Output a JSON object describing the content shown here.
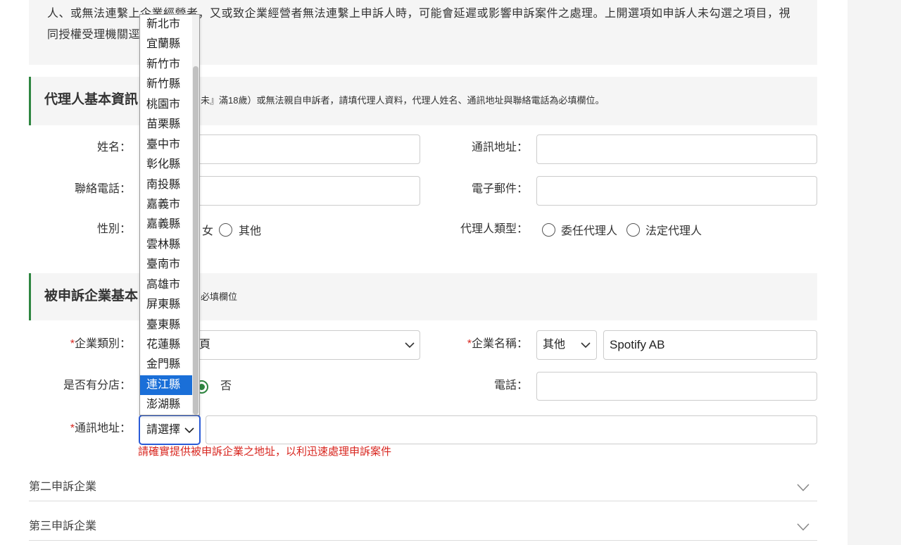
{
  "colors": {
    "accent_green": "#2e8540",
    "highlight_blue": "#1a6fd8",
    "error_red": "#d8261f",
    "panel_gray": "#f5f5f5",
    "gutter_gray": "#f4f4f4"
  },
  "icons": {
    "select_arrow": "chevron-down-icon",
    "accordion_toggle": "chevron-down-icon"
  },
  "notice": {
    "line1": "人、或無法連繫上企業經營者，又或致企業經營者無法連繫上申訴人時，可能會延遲或影響申訴案件之處理。上開選項如申訴人未勾選之項目，視",
    "line2": "同授權受理機關逕"
  },
  "agent": {
    "title": "代理人基本資訊",
    "note": "未』滿18歲）或無法親自申訴者，請填代理人資料，代理人姓名、通訊地址與聯絡電話為必填欄位。",
    "name": {
      "label": "姓名：",
      "value": ""
    },
    "address": {
      "label": "通訊地址：",
      "value": ""
    },
    "phone": {
      "label": "聯絡電話：",
      "value": ""
    },
    "email": {
      "label": "電子郵件：",
      "value": ""
    },
    "gender": {
      "label": "性別：",
      "options": [
        {
          "label": "女"
        },
        {
          "label": "其他",
          "checked": false
        }
      ]
    },
    "type": {
      "label": "代理人類型：",
      "options": [
        {
          "label": "委任代理人",
          "checked": false
        },
        {
          "label": "法定代理人",
          "checked": false
        }
      ]
    }
  },
  "company": {
    "title": "被申訴企業基本",
    "note": "必填欄位",
    "required_mark": "*",
    "type": {
      "label": "企業類別：",
      "value": "頁"
    },
    "name": {
      "label": "企業名稱：",
      "select_value": "其他",
      "value": "Spotify AB"
    },
    "branch": {
      "label": "是否有分店：",
      "options": [
        {
          "label": "否",
          "checked": true
        }
      ]
    },
    "phone": {
      "label": "電話：",
      "value": ""
    },
    "address": {
      "label": "通訊地址：",
      "select_value": "請選擇",
      "value": "",
      "hint": "請確實提供被申訴企業之地址，以利迅速處理申訴案件"
    }
  },
  "accordions": [
    {
      "label": "第二申訴企業"
    },
    {
      "label": "第三申訴企業"
    }
  ],
  "dropdown": {
    "options": [
      "新北市",
      "宜蘭縣",
      "新竹市",
      "新竹縣",
      "桃園市",
      "苗栗縣",
      "臺中市",
      "彰化縣",
      "南投縣",
      "嘉義市",
      "嘉義縣",
      "雲林縣",
      "臺南市",
      "高雄市",
      "屏東縣",
      "臺東縣",
      "花蓮縣",
      "金門縣",
      "連江縣",
      "澎湖縣"
    ],
    "highlighted_index": 18
  }
}
